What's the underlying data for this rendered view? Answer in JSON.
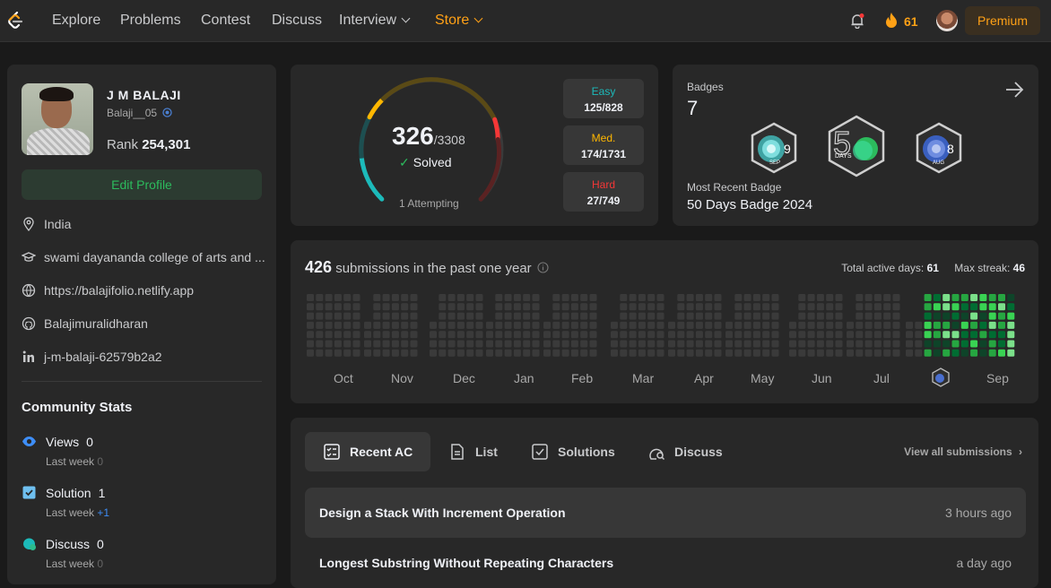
{
  "nav": {
    "items": [
      "Explore",
      "Problems",
      "Contest",
      "Discuss",
      "Interview",
      "Store"
    ],
    "streak": "61",
    "premium": "Premium"
  },
  "profile": {
    "name": "J M BALAJI",
    "handle": "Balaji__05",
    "rank_label": "Rank",
    "rank": "254,301",
    "edit": "Edit Profile",
    "location": "India",
    "school": "swami dayananda college of arts and ...",
    "website": "https://balajifolio.netlify.app",
    "github": "Balajimuralidharan",
    "linkedin": "j-m-balaji-62579b2a2"
  },
  "community": {
    "title": "Community Stats",
    "last_week_label": "Last week",
    "views": {
      "label": "Views",
      "value": "0",
      "delta": "0"
    },
    "solution": {
      "label": "Solution",
      "value": "1",
      "delta": "+1"
    },
    "discuss": {
      "label": "Discuss",
      "value": "0",
      "delta": "0"
    }
  },
  "solved": {
    "count": "326",
    "total": "/3308",
    "label": "Solved",
    "attempting": "1 Attempting",
    "easy": {
      "label": "Easy",
      "value": "125/828",
      "color": "#1cbaba"
    },
    "medium": {
      "label": "Med.",
      "value": "174/1731",
      "color": "#ffb700"
    },
    "hard": {
      "label": "Hard",
      "value": "27/749",
      "color": "#f63737"
    }
  },
  "badges": {
    "label": "Badges",
    "count": "7",
    "recent_label": "Most Recent Badge",
    "recent": "50 Days Badge 2024",
    "items": [
      {
        "icon": "sep-badge-icon",
        "num": "9",
        "mon": "SEP"
      },
      {
        "icon": "50-days-badge-icon",
        "num": "5",
        "mon": "DAYS"
      },
      {
        "icon": "aug-badge-icon",
        "num": "8",
        "mon": "AUG"
      }
    ]
  },
  "submissions": {
    "count": "426",
    "label": "submissions in the past one year",
    "active_label": "Total active days:",
    "active": "61",
    "streak_label": "Max streak:",
    "streak": "46",
    "months": [
      "Oct",
      "Nov",
      "Dec",
      "Jan",
      "Feb",
      "Mar",
      "Apr",
      "May",
      "Jun",
      "Jul",
      "Sep"
    ]
  },
  "tabs": {
    "recent": "Recent AC",
    "list": "List",
    "solutions": "Solutions",
    "discuss": "Discuss",
    "view_all": "View all submissions"
  },
  "recent": [
    {
      "title": "Design a Stack With Increment Operation",
      "time": "3 hours ago"
    },
    {
      "title": "Longest Substring Without Repeating Characters",
      "time": "a day ago"
    }
  ]
}
